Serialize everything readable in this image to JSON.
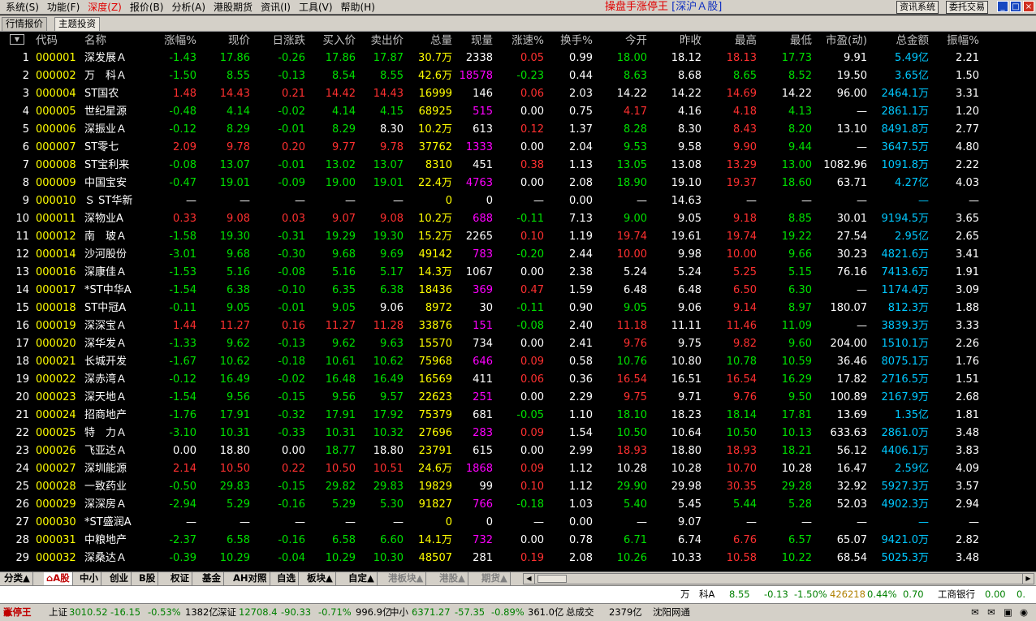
{
  "menus": [
    "系统(S)",
    "功能(F)",
    "深度(Z)",
    "报价(B)",
    "分析(A)",
    "港股期货",
    "资讯(I)",
    "工具(V)",
    "帮助(H)"
  ],
  "active_menu_index": 2,
  "app_title": "操盘手涨停王",
  "market": "[深沪Ａ股]",
  "top_buttons": {
    "news": "资讯系统",
    "trade": "委托交易"
  },
  "top_tabs": [
    "行情报价",
    "主题投资"
  ],
  "active_top_tab": 1,
  "columns": [
    "代码",
    "名称",
    "涨幅%",
    "现价",
    "日涨跌",
    "买入价",
    "卖出价",
    "总量",
    "现量",
    "涨速%",
    "换手%",
    "今开",
    "昨收",
    "最高",
    "最低",
    "市盈(动)",
    "总金额",
    "振幅%"
  ],
  "rows": [
    [
      "1",
      "000001",
      "深发展Ａ",
      "-1.43",
      "17.86",
      "-0.26",
      "17.86",
      "17.87",
      "30.7万",
      "2338",
      "0.05",
      "0.99",
      "18.00",
      "18.12",
      "18.13",
      "17.73",
      "9.91",
      "5.49亿",
      "2.21"
    ],
    [
      "2",
      "000002",
      "万　科Ａ",
      "-1.50",
      "8.55",
      "-0.13",
      "8.54",
      "8.55",
      "42.6万",
      "18578",
      "-0.23",
      "0.44",
      "8.63",
      "8.68",
      "8.65",
      "8.52",
      "19.50",
      "3.65亿",
      "1.50"
    ],
    [
      "3",
      "000004",
      "ST国农",
      "1.48",
      "14.43",
      "0.21",
      "14.42",
      "14.43",
      "16999",
      "146",
      "0.06",
      "2.03",
      "14.22",
      "14.22",
      "14.69",
      "14.22",
      "96.00",
      "2464.1万",
      "3.31"
    ],
    [
      "4",
      "000005",
      "世纪星源",
      "-0.48",
      "4.14",
      "-0.02",
      "4.14",
      "4.15",
      "68925",
      "515",
      "0.00",
      "0.75",
      "4.17",
      "4.16",
      "4.18",
      "4.13",
      "—",
      "2861.1万",
      "1.20"
    ],
    [
      "5",
      "000006",
      "深振业Ａ",
      "-0.12",
      "8.29",
      "-0.01",
      "8.29",
      "8.30",
      "10.2万",
      "613",
      "0.12",
      "1.37",
      "8.28",
      "8.30",
      "8.43",
      "8.20",
      "13.10",
      "8491.8万",
      "2.77"
    ],
    [
      "6",
      "000007",
      "ST零七",
      "2.09",
      "9.78",
      "0.20",
      "9.77",
      "9.78",
      "37762",
      "1333",
      "0.00",
      "2.04",
      "9.53",
      "9.58",
      "9.90",
      "9.44",
      "—",
      "3647.5万",
      "4.80"
    ],
    [
      "7",
      "000008",
      "ST宝利来",
      "-0.08",
      "13.07",
      "-0.01",
      "13.02",
      "13.07",
      "8310",
      "451",
      "0.38",
      "1.13",
      "13.05",
      "13.08",
      "13.29",
      "13.00",
      "1082.96",
      "1091.8万",
      "2.22"
    ],
    [
      "8",
      "000009",
      "中国宝安",
      "-0.47",
      "19.01",
      "-0.09",
      "19.00",
      "19.01",
      "22.4万",
      "4763",
      "0.00",
      "2.08",
      "18.90",
      "19.10",
      "19.37",
      "18.60",
      "63.71",
      "4.27亿",
      "4.03"
    ],
    [
      "9",
      "000010",
      "Ｓ ST华新",
      "—",
      "—",
      "—",
      "—",
      "—",
      "0",
      "0",
      "—",
      "0.00",
      "—",
      "14.63",
      "—",
      "—",
      "—",
      "—",
      "—"
    ],
    [
      "10",
      "000011",
      "深物业A",
      "0.33",
      "9.08",
      "0.03",
      "9.07",
      "9.08",
      "10.2万",
      "688",
      "-0.11",
      "7.13",
      "9.00",
      "9.05",
      "9.18",
      "8.85",
      "30.01",
      "9194.5万",
      "3.65"
    ],
    [
      "11",
      "000012",
      "南　玻Ａ",
      "-1.58",
      "19.30",
      "-0.31",
      "19.29",
      "19.30",
      "15.2万",
      "2265",
      "0.10",
      "1.19",
      "19.74",
      "19.61",
      "19.74",
      "19.22",
      "27.54",
      "2.95亿",
      "2.65"
    ],
    [
      "12",
      "000014",
      "沙河股份",
      "-3.01",
      "9.68",
      "-0.30",
      "9.68",
      "9.69",
      "49142",
      "783",
      "-0.20",
      "2.44",
      "10.00",
      "9.98",
      "10.00",
      "9.66",
      "30.23",
      "4821.6万",
      "3.41"
    ],
    [
      "13",
      "000016",
      "深康佳Ａ",
      "-1.53",
      "5.16",
      "-0.08",
      "5.16",
      "5.17",
      "14.3万",
      "1067",
      "0.00",
      "2.38",
      "5.24",
      "5.24",
      "5.25",
      "5.15",
      "76.16",
      "7413.6万",
      "1.91"
    ],
    [
      "14",
      "000017",
      "*ST中华A",
      "-1.54",
      "6.38",
      "-0.10",
      "6.35",
      "6.38",
      "18436",
      "369",
      "0.47",
      "1.59",
      "6.48",
      "6.48",
      "6.50",
      "6.30",
      "—",
      "1174.4万",
      "3.09"
    ],
    [
      "15",
      "000018",
      "ST中冠A",
      "-0.11",
      "9.05",
      "-0.01",
      "9.05",
      "9.06",
      "8972",
      "30",
      "-0.11",
      "0.90",
      "9.05",
      "9.06",
      "9.14",
      "8.97",
      "180.07",
      "812.3万",
      "1.88"
    ],
    [
      "16",
      "000019",
      "深深宝Ａ",
      "1.44",
      "11.27",
      "0.16",
      "11.27",
      "11.28",
      "33876",
      "151",
      "-0.08",
      "2.40",
      "11.18",
      "11.11",
      "11.46",
      "11.09",
      "—",
      "3839.3万",
      "3.33"
    ],
    [
      "17",
      "000020",
      "深华发Ａ",
      "-1.33",
      "9.62",
      "-0.13",
      "9.62",
      "9.63",
      "15570",
      "734",
      "0.00",
      "2.41",
      "9.76",
      "9.75",
      "9.82",
      "9.60",
      "204.00",
      "1510.1万",
      "2.26"
    ],
    [
      "18",
      "000021",
      "长城开发",
      "-1.67",
      "10.62",
      "-0.18",
      "10.61",
      "10.62",
      "75968",
      "646",
      "0.09",
      "0.58",
      "10.76",
      "10.80",
      "10.78",
      "10.59",
      "36.46",
      "8075.1万",
      "1.76"
    ],
    [
      "19",
      "000022",
      "深赤湾Ａ",
      "-0.12",
      "16.49",
      "-0.02",
      "16.48",
      "16.49",
      "16569",
      "411",
      "0.06",
      "0.36",
      "16.54",
      "16.51",
      "16.54",
      "16.29",
      "17.82",
      "2716.5万",
      "1.51"
    ],
    [
      "20",
      "000023",
      "深天地Ａ",
      "-1.54",
      "9.56",
      "-0.15",
      "9.56",
      "9.57",
      "22623",
      "251",
      "0.00",
      "2.29",
      "9.75",
      "9.71",
      "9.76",
      "9.50",
      "100.89",
      "2167.9万",
      "2.68"
    ],
    [
      "21",
      "000024",
      "招商地产",
      "-1.76",
      "17.91",
      "-0.32",
      "17.91",
      "17.92",
      "75379",
      "681",
      "-0.05",
      "1.10",
      "18.10",
      "18.23",
      "18.14",
      "17.81",
      "13.69",
      "1.35亿",
      "1.81"
    ],
    [
      "22",
      "000025",
      "特　力Ａ",
      "-3.10",
      "10.31",
      "-0.33",
      "10.31",
      "10.32",
      "27696",
      "283",
      "0.09",
      "1.54",
      "10.50",
      "10.64",
      "10.50",
      "10.13",
      "633.63",
      "2861.0万",
      "3.48"
    ],
    [
      "23",
      "000026",
      "飞亚达Ａ",
      "0.00",
      "18.80",
      "0.00",
      "18.77",
      "18.80",
      "23791",
      "615",
      "0.00",
      "2.99",
      "18.93",
      "18.80",
      "18.93",
      "18.21",
      "56.12",
      "4406.1万",
      "3.83"
    ],
    [
      "24",
      "000027",
      "深圳能源",
      "2.14",
      "10.50",
      "0.22",
      "10.50",
      "10.51",
      "24.6万",
      "1868",
      "0.09",
      "1.12",
      "10.28",
      "10.28",
      "10.70",
      "10.28",
      "16.47",
      "2.59亿",
      "4.09"
    ],
    [
      "25",
      "000028",
      "一致药业",
      "-0.50",
      "29.83",
      "-0.15",
      "29.82",
      "29.83",
      "19829",
      "99",
      "0.10",
      "1.12",
      "29.90",
      "29.98",
      "30.35",
      "29.28",
      "32.92",
      "5927.3万",
      "3.57"
    ],
    [
      "26",
      "000029",
      "深深房Ａ",
      "-2.94",
      "5.29",
      "-0.16",
      "5.29",
      "5.30",
      "91827",
      "766",
      "-0.18",
      "1.03",
      "5.40",
      "5.45",
      "5.44",
      "5.28",
      "52.03",
      "4902.3万",
      "2.94"
    ],
    [
      "27",
      "000030",
      "*ST盛润A",
      "—",
      "—",
      "—",
      "—",
      "—",
      "0",
      "0",
      "—",
      "0.00",
      "—",
      "9.07",
      "—",
      "—",
      "—",
      "—",
      "—"
    ],
    [
      "28",
      "000031",
      "中粮地产",
      "-2.37",
      "6.58",
      "-0.16",
      "6.58",
      "6.60",
      "14.1万",
      "732",
      "0.00",
      "0.78",
      "6.71",
      "6.74",
      "6.76",
      "6.57",
      "65.07",
      "9421.0万",
      "2.82"
    ],
    [
      "29",
      "000032",
      "深桑达Ａ",
      "-0.39",
      "10.29",
      "-0.04",
      "10.29",
      "10.30",
      "48507",
      "281",
      "0.19",
      "2.08",
      "10.26",
      "10.33",
      "10.58",
      "10.22",
      "68.54",
      "5025.3万",
      "3.48"
    ]
  ],
  "bottom_tabs": [
    "分类▲",
    "A股",
    "中小",
    "创业",
    "B股",
    "权证",
    "基金",
    "AH对照",
    "自选",
    "板块▲",
    "自定▲",
    "港板块▲",
    "港股▲",
    "期货▲"
  ],
  "active_bottom_tab": 1,
  "status_quote": {
    "name": "万　科A",
    "price": "8.55",
    "change": "-0.13",
    "pct": "-1.50%",
    "volume": "426218",
    "turnover": "0.44%",
    "pe": "0.70",
    "name2": "工商银行",
    "price2": "0.00",
    "change2": "0."
  },
  "status_index": {
    "brand": "涨停王",
    "sh_label": "上证",
    "sh_value": "3010.52",
    "sh_change": "-16.15",
    "sh_pct": "-0.53%",
    "sh_amount": "1382亿",
    "sz_label": "深证",
    "sz_value": "12708.4",
    "sz_change": "-90.33",
    "sz_pct": "-0.71%",
    "sz_amount": "996.9亿",
    "zx_label": "中小",
    "zx_value": "6371.27",
    "zx_change": "-57.35",
    "zx_pct": "-0.89%",
    "zx_amount": "361.0亿",
    "total_label": "总成交",
    "total_value": "2379亿",
    "server": "沈阳网通"
  }
}
